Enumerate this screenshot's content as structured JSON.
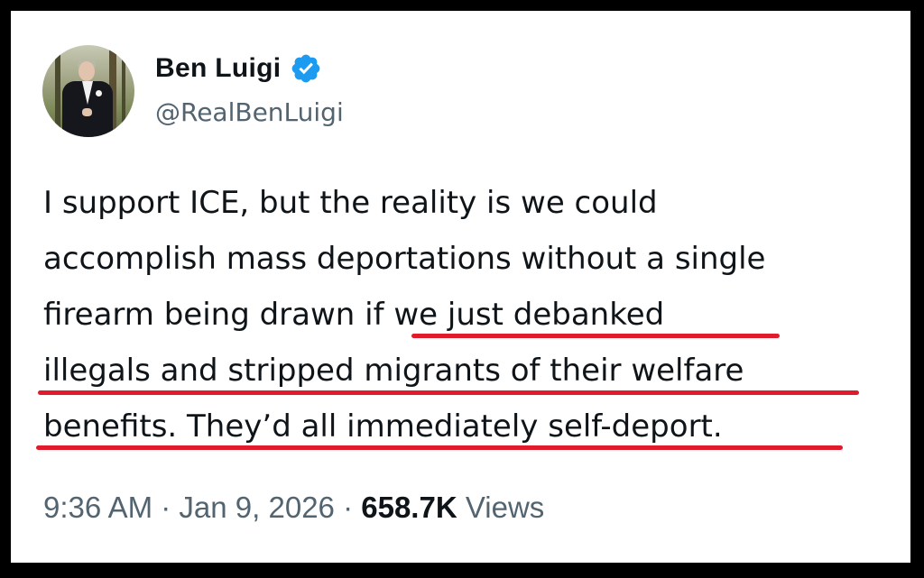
{
  "tweet": {
    "author": {
      "display_name": "Ben Luigi",
      "handle": "@RealBenLuigi",
      "verified": true,
      "verified_icon": "verified-badge-icon"
    },
    "text_lines": [
      "I support ICE, but the reality is we could",
      "accomplish mass deportations without a single",
      "firearm being drawn if we just debanked",
      "illegals and stripped migrants of their welfare",
      "benefits. They’d all immediately self-deport."
    ],
    "meta": {
      "time": "9:36 AM",
      "separator": "·",
      "date": "Jan 9, 2026",
      "views_count": "658.7K",
      "views_label": "Views"
    }
  },
  "colors": {
    "background_frame": "#000000",
    "card": "#ffffff",
    "text": "#0f1419",
    "secondary_text": "#536471",
    "verified_blue": "#1d9bf0",
    "highlight_underline": "#e01b2b"
  }
}
